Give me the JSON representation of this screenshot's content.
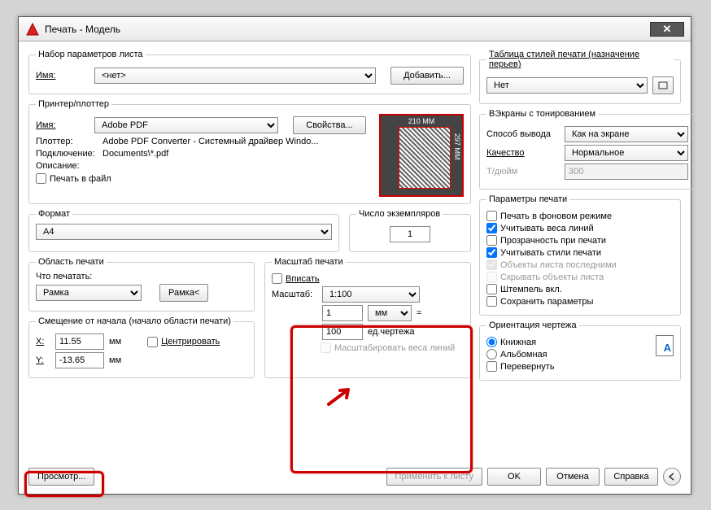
{
  "window": {
    "title": "Печать - Модель"
  },
  "page_setup": {
    "legend": "Набор параметров листа",
    "name_label": "Имя:",
    "name_value": "<нет>",
    "add": "Добавить..."
  },
  "plot_style": {
    "legend": "Таблица стилей печати (назначение перьев)",
    "value": "Нет"
  },
  "printer": {
    "legend": "Принтер/плоттер",
    "name_label": "Имя:",
    "name_value": "Adobe PDF",
    "props": "Свойства...",
    "plotter_label": "Плоттер:",
    "plotter_value": "Adobe PDF Converter - Системный драйвер Windo...",
    "conn_label": "Подключение:",
    "conn_value": "Documents\\*.pdf",
    "desc_label": "Описание:",
    "tofile": "Печать в файл",
    "paper_w": "210 MM",
    "paper_h": "297 MM"
  },
  "shaded": {
    "legend": "ВЭкраны с тонированием",
    "mode_label": "Способ вывода",
    "mode_value": "Как на экране",
    "quality_label": "Качество",
    "quality_value": "Нормальное",
    "dpi_label": "Т/дюйм",
    "dpi_value": "300"
  },
  "format": {
    "legend": "Формат",
    "value": "A4"
  },
  "copies": {
    "legend": "Число экземпляров",
    "value": "1"
  },
  "options": {
    "legend": "Параметры печати",
    "bg": "Печать в фоновом режиме",
    "lw": "Учитывать веса линий",
    "transp": "Прозрачность при печати",
    "styles": "Учитывать стили печати",
    "paperspace": "Объекты листа последними",
    "hide": "Скрывать объекты листа",
    "stamp": "Штемпель вкл.",
    "save": "Сохранить параметры"
  },
  "area": {
    "legend": "Область печати",
    "what": "Что печатать:",
    "value": "Рамка",
    "window_btn": "Рамка<"
  },
  "scale": {
    "legend": "Масштаб печати",
    "fit": "Вписать",
    "scale_label": "Масштаб:",
    "scale_value": "1:100",
    "unit_value": "1",
    "unit_sel": "мм",
    "drawing_value": "100",
    "drawing_label": "ед.чертежа",
    "scale_lw": "Масштабировать веса линий",
    "equals": "="
  },
  "offset": {
    "legend": "Смещение от начала (начало области печати)",
    "x_label": "X:",
    "x_value": "11.55",
    "y_label": "Y:",
    "y_value": "-13.65",
    "unit": "мм",
    "center": "Центрировать"
  },
  "orient": {
    "legend": "Ориентация чертежа",
    "portrait": "Книжная",
    "landscape": "Альбомная",
    "upside": "Перевернуть"
  },
  "footer": {
    "preview": "Просмотр...",
    "apply": "Применить к листу",
    "ok": "OK",
    "cancel": "Отмена",
    "help": "Справка"
  }
}
